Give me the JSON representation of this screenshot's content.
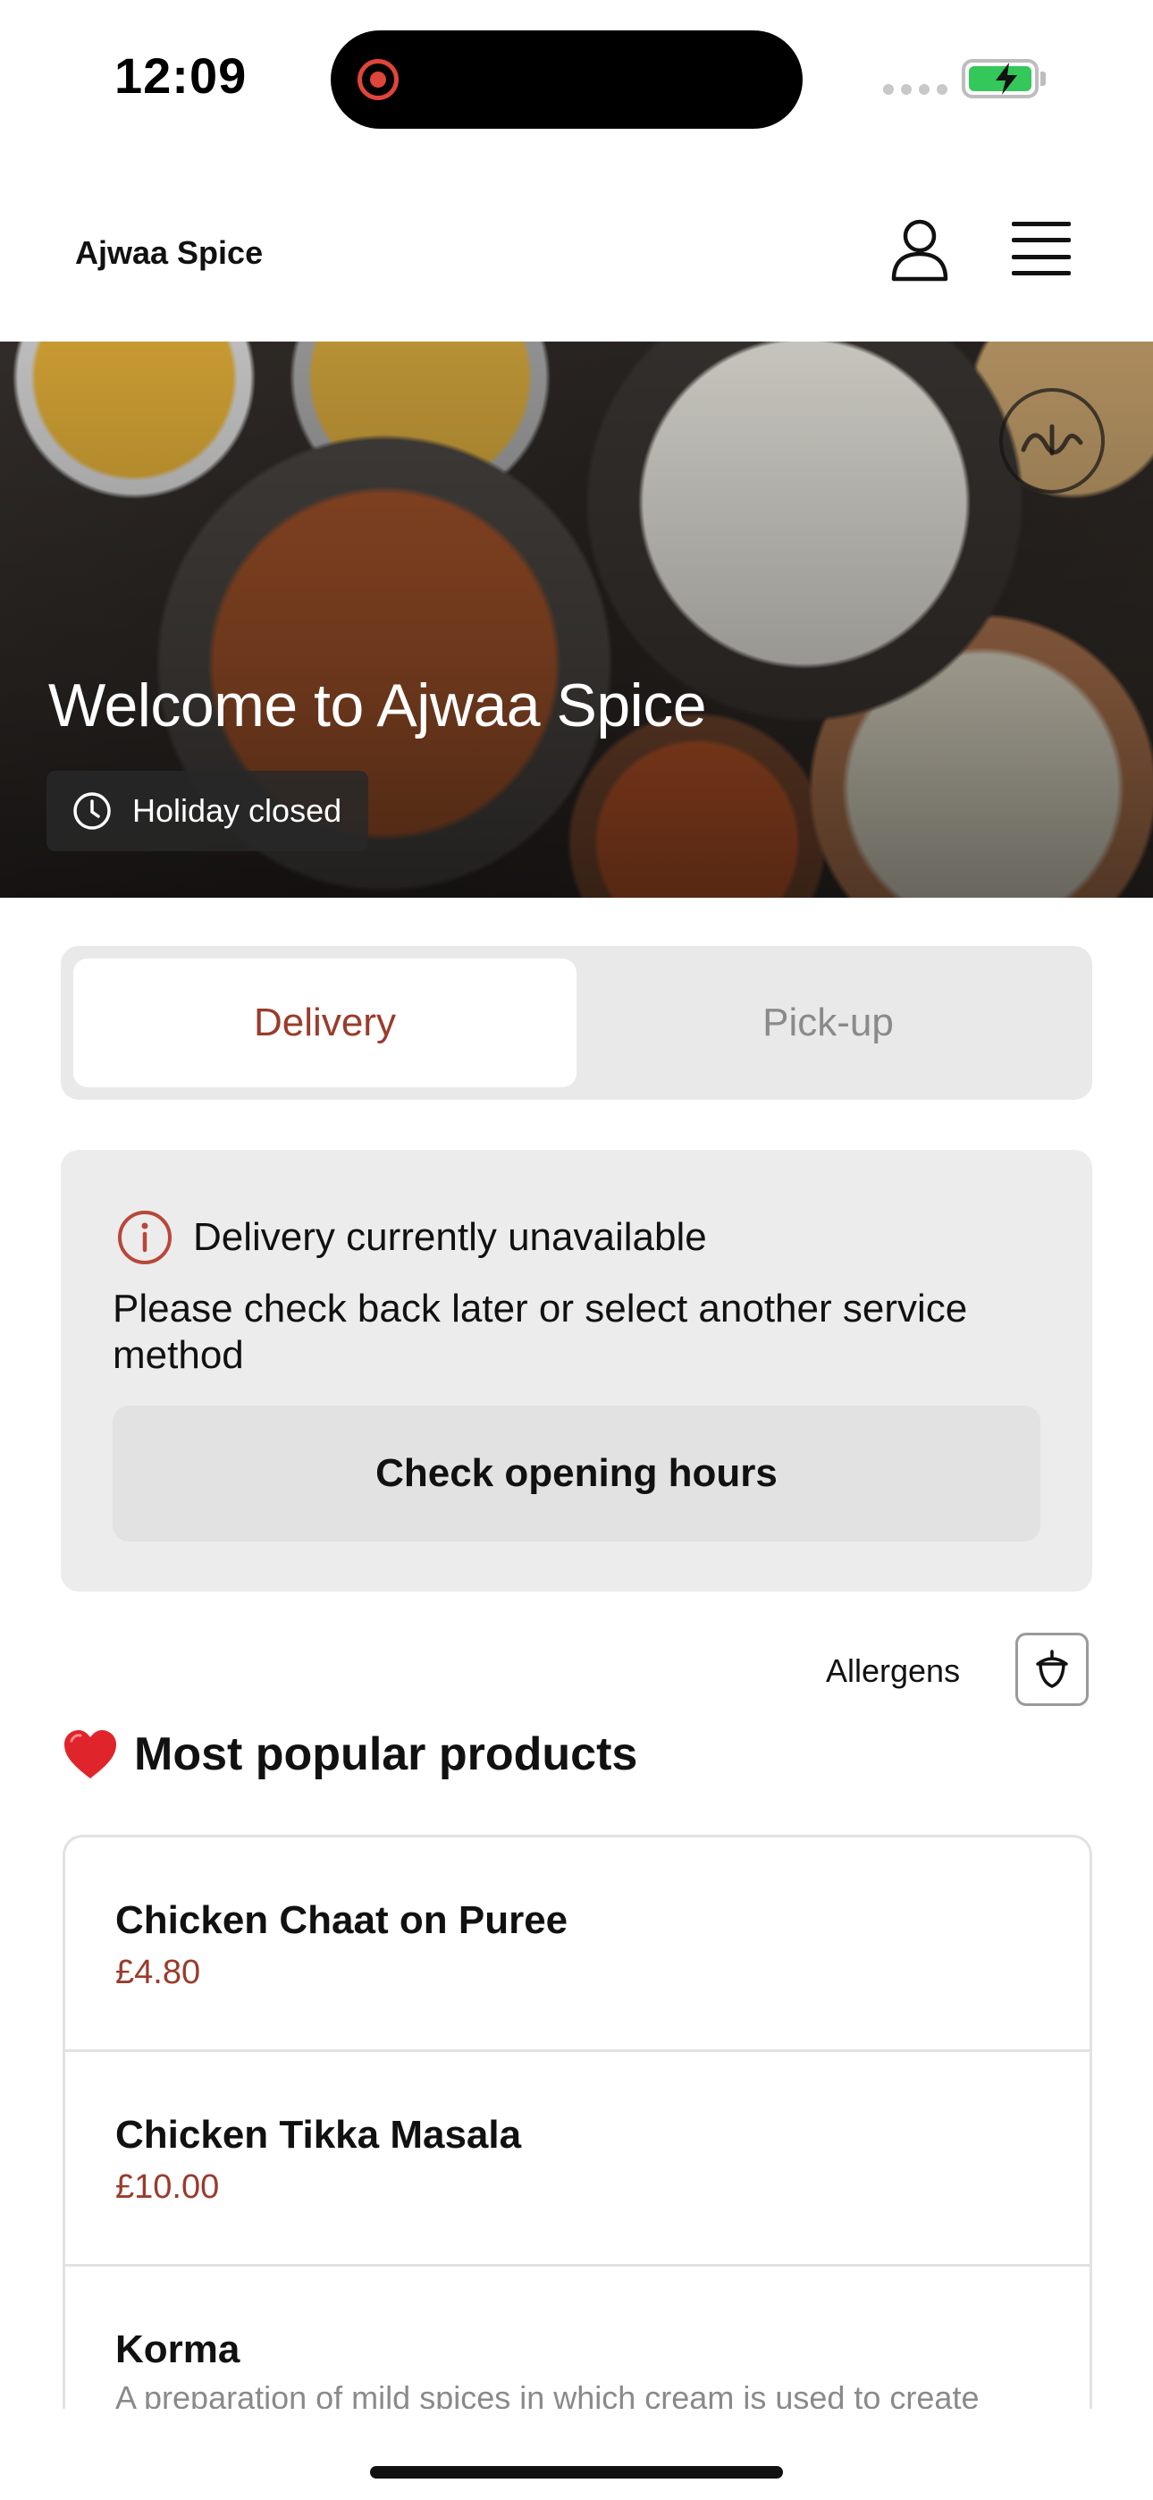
{
  "status_bar": {
    "time": "12:09"
  },
  "header": {
    "brand": "Ajwaa Spice"
  },
  "hero": {
    "title": "Welcome to Ajwaa Spice",
    "status": "Holiday closed"
  },
  "tabs": [
    {
      "label": "Delivery",
      "active": true
    },
    {
      "label": "Pick-up",
      "active": false
    }
  ],
  "notice": {
    "title": "Delivery currently unavailable",
    "body": "Please check back later or select another service method",
    "button": "Check opening hours"
  },
  "allergens": {
    "label": "Allergens"
  },
  "popular": {
    "title": "Most popular products"
  },
  "products": [
    {
      "name": "Chicken Chaat on Puree",
      "price": "£4.80"
    },
    {
      "name": "Chicken Tikka Masala",
      "price": "£10.00"
    },
    {
      "name": "Korma",
      "description": "A preparation of mild spices in which cream is used to create"
    }
  ],
  "colors": {
    "accent": "#9a3b2c",
    "panel": "#ececec",
    "battery": "#34c759"
  },
  "icons": [
    "record-icon",
    "battery-icon",
    "profile-icon",
    "menu-icon",
    "halal-icon",
    "clock-icon",
    "info-icon",
    "acorn-icon",
    "heart-icon"
  ]
}
